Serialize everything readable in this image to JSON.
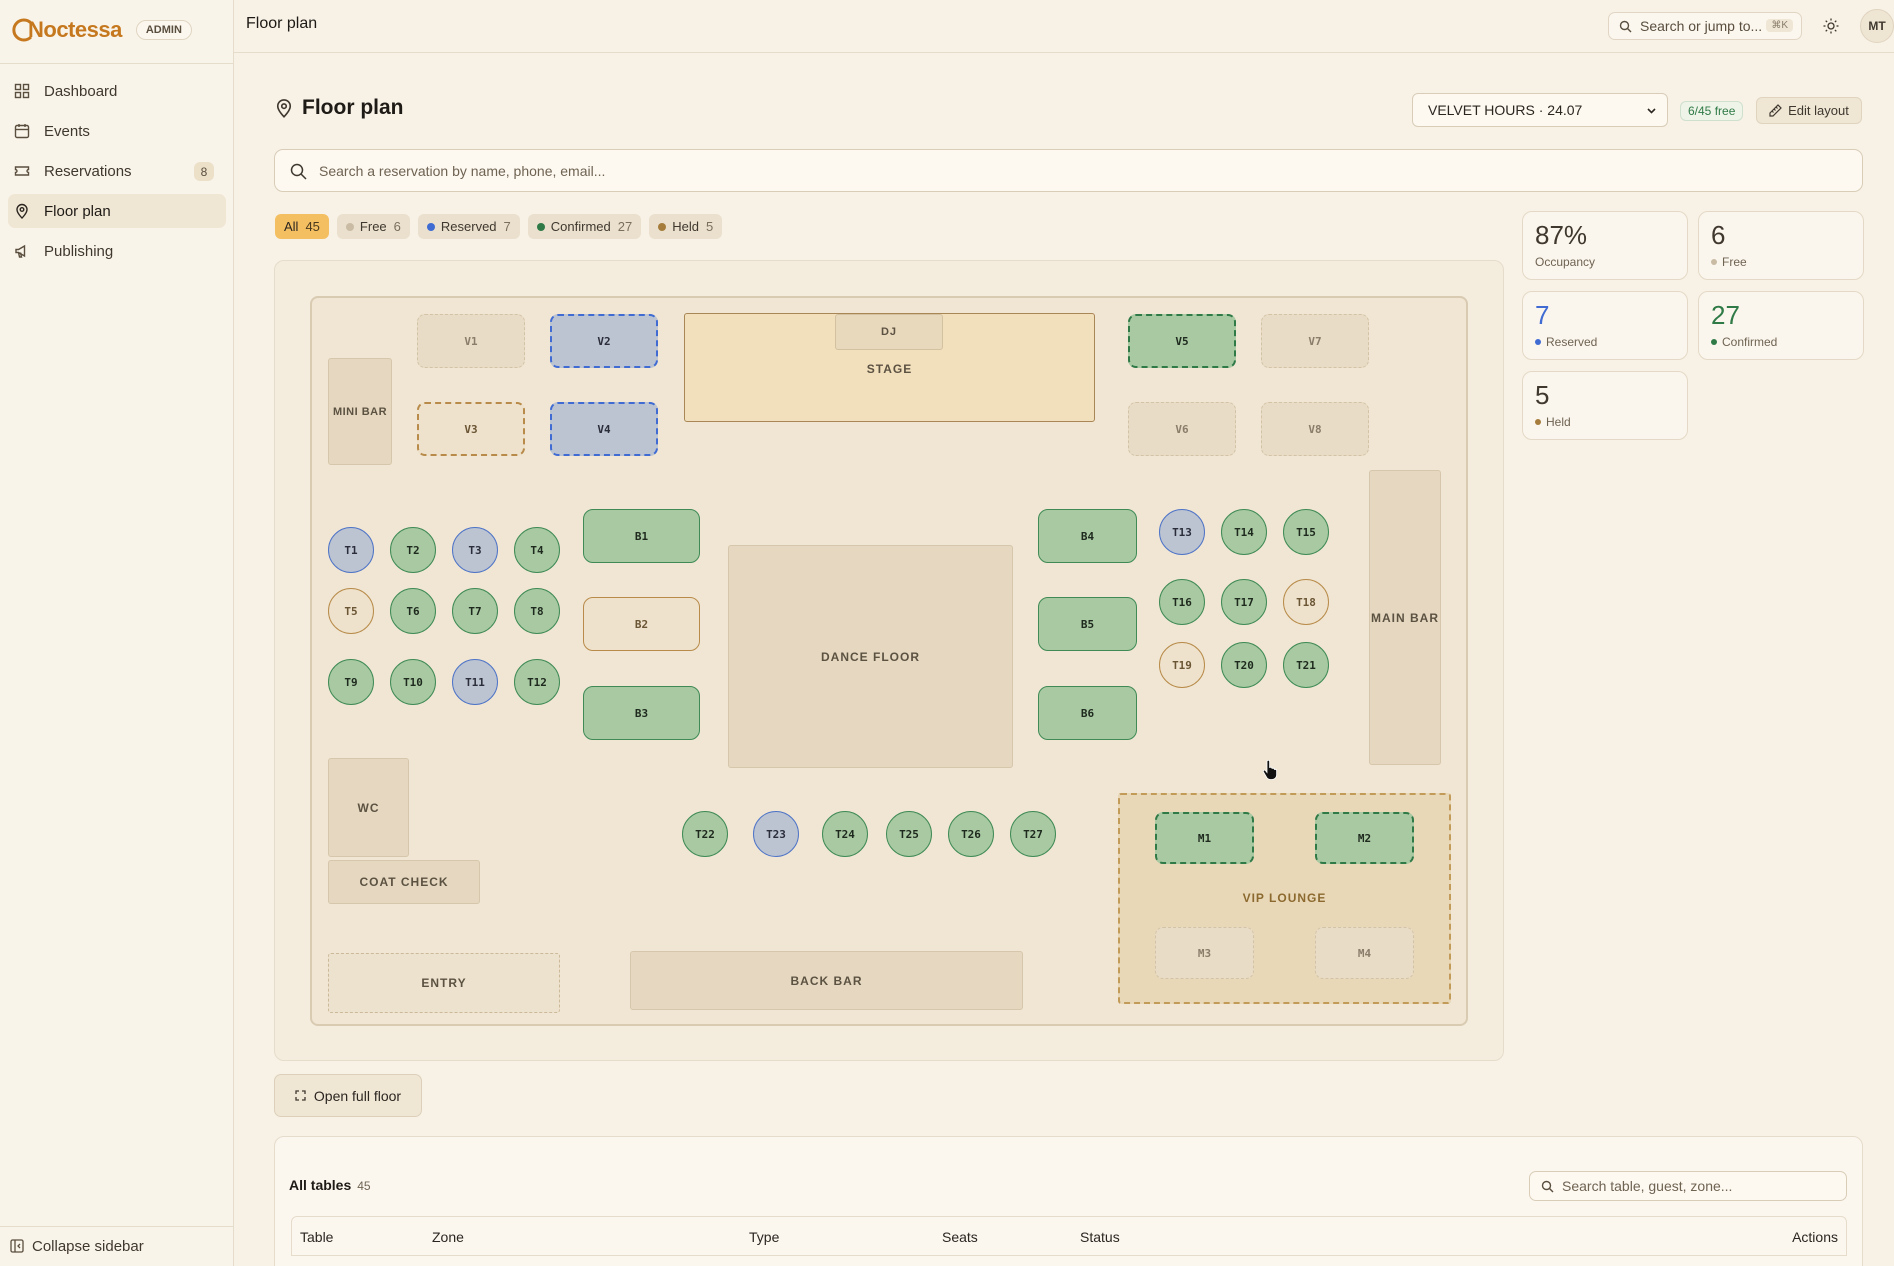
{
  "app": {
    "brand": "Noctessa",
    "role_badge": "ADMIN"
  },
  "sidebar": {
    "items": [
      {
        "label": "Dashboard",
        "icon": "dashboard-icon"
      },
      {
        "label": "Events",
        "icon": "calendar-icon"
      },
      {
        "label": "Reservations",
        "icon": "ticket-icon",
        "badge": "8"
      },
      {
        "label": "Floor plan",
        "icon": "map-pin-icon",
        "active": true
      },
      {
        "label": "Publishing",
        "icon": "megaphone-icon"
      }
    ],
    "collapse_label": "Collapse sidebar"
  },
  "topbar": {
    "breadcrumb": "Floor plan",
    "search_placeholder": "Search or jump to...",
    "search_shortcut": "⌘K",
    "avatar_initials": "MT"
  },
  "page": {
    "title": "Floor plan",
    "event_selected": "VELVET HOURS · 24.07",
    "free_summary": "6/45 free",
    "edit_layout_label": "Edit layout",
    "reservation_search_placeholder": "Search a reservation by name, phone, email..."
  },
  "filters": [
    {
      "label": "All",
      "count": "45",
      "active": true
    },
    {
      "label": "Free",
      "count": "6",
      "dot": "#c9bba4"
    },
    {
      "label": "Reserved",
      "count": "7",
      "dot": "#3f6bd3"
    },
    {
      "label": "Confirmed",
      "count": "27",
      "dot": "#2f7a47"
    },
    {
      "label": "Held",
      "count": "5",
      "dot": "#a67c3c"
    }
  ],
  "stats": [
    {
      "value": "87%",
      "label": "Occupancy"
    },
    {
      "value": "6",
      "label": "Free",
      "color": "#3f382f",
      "dot": "#c9bba4"
    },
    {
      "value": "7",
      "label": "Reserved",
      "color": "#3f6bd3",
      "dot": "#3f6bd3"
    },
    {
      "value": "27",
      "label": "Confirmed",
      "color": "#2f7a47",
      "dot": "#2f7a47"
    },
    {
      "value": "5",
      "label": "Held",
      "color": "#3f382f",
      "dot": "#a67c3c"
    }
  ],
  "floor": {
    "zones": {
      "mini_bar": "MINI BAR",
      "dj": "DJ",
      "stage": "STAGE",
      "dance_floor": "DANCE FLOOR",
      "main_bar": "MAIN BAR",
      "wc": "WC",
      "coat_check": "COAT CHECK",
      "entry": "ENTRY",
      "back_bar": "BACK BAR",
      "vip_lounge": "VIP LOUNGE"
    },
    "tables": {
      "V1": "free",
      "V2": "reserved",
      "V3": "held",
      "V4": "reserved",
      "V5": "confirmed",
      "V6": "free",
      "V7": "free",
      "V8": "free",
      "T1": "reserved",
      "T2": "confirmed",
      "T3": "reserved",
      "T4": "confirmed",
      "T5": "held",
      "T6": "confirmed",
      "T7": "confirmed",
      "T8": "confirmed",
      "T9": "confirmed",
      "T10": "confirmed",
      "T11": "reserved",
      "T12": "confirmed",
      "B1": "confirmed",
      "B2": "held",
      "B3": "confirmed",
      "B4": "confirmed",
      "B5": "confirmed",
      "B6": "confirmed",
      "T13": "reserved",
      "T14": "confirmed",
      "T15": "confirmed",
      "T16": "confirmed",
      "T17": "confirmed",
      "T18": "held",
      "T19": "held",
      "T20": "confirmed",
      "T21": "confirmed",
      "T22": "confirmed",
      "T23": "reserved",
      "T24": "confirmed",
      "T25": "confirmed",
      "T26": "confirmed",
      "T27": "confirmed",
      "M1": "confirmed",
      "M2": "confirmed",
      "M3": "free",
      "M4": "free"
    }
  },
  "bottom": {
    "open_full_floor_label": "Open full floor",
    "tables_title": "All tables",
    "tables_count": "45",
    "tables_search_placeholder": "Search table, guest, zone...",
    "columns": [
      "Table",
      "Zone",
      "Type",
      "Seats",
      "Status",
      "Actions"
    ]
  }
}
